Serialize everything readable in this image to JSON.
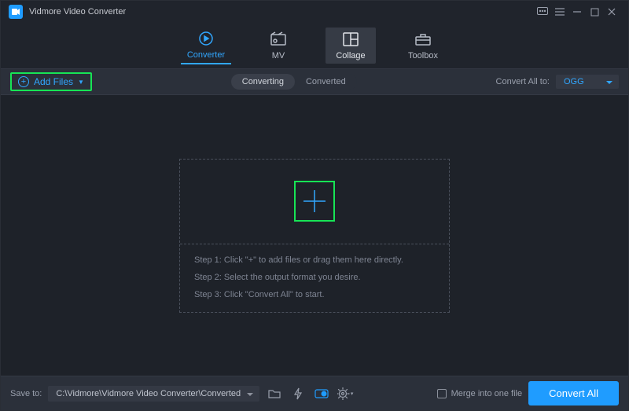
{
  "titlebar": {
    "title": "Vidmore Video Converter"
  },
  "tabs": {
    "converter": "Converter",
    "mv": "MV",
    "collage": "Collage",
    "toolbox": "Toolbox"
  },
  "toolbar": {
    "add_files": "Add Files",
    "converting": "Converting",
    "converted": "Converted",
    "convert_all_to": "Convert All to:",
    "format": "OGG"
  },
  "drop": {
    "step1": "Step 1: Click \"+\" to add files or drag them here directly.",
    "step2": "Step 2: Select the output format you desire.",
    "step3": "Step 3: Click \"Convert All\" to start."
  },
  "footer": {
    "save_to": "Save to:",
    "path": "C:\\Vidmore\\Vidmore Video Converter\\Converted",
    "merge": "Merge into one file",
    "convert_all": "Convert All"
  }
}
